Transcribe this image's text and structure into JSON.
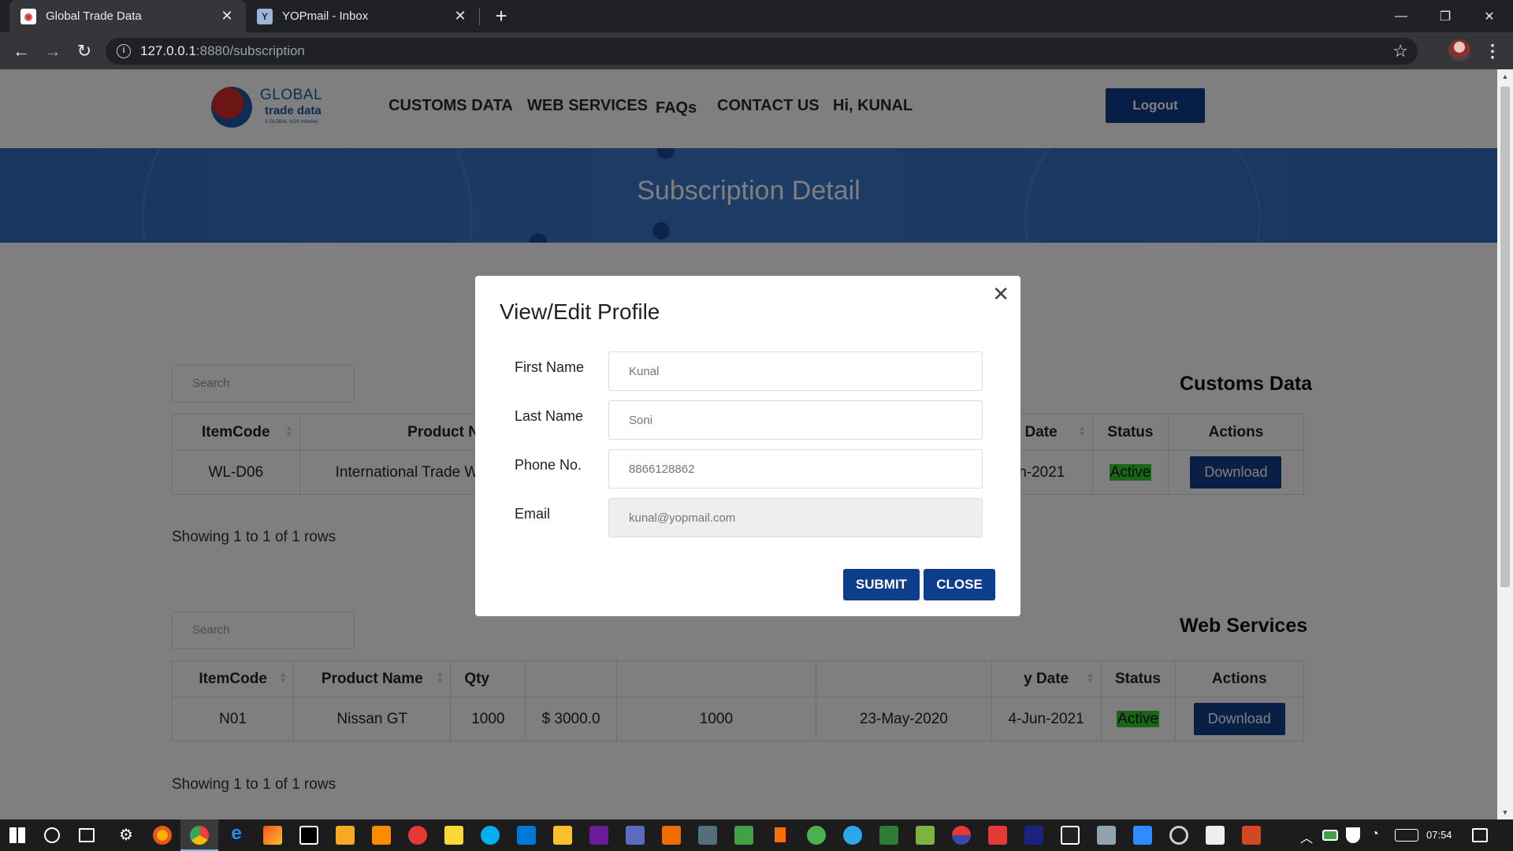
{
  "browser": {
    "tabs": [
      {
        "title": "Global Trade Data",
        "favicon": "gtd-globe-icon",
        "active": true
      },
      {
        "title": "YOPmail - Inbox",
        "favicon": "yopmail-icon",
        "active": false
      }
    ],
    "url": {
      "host": "127.0.0.1",
      "path": ":8880/subscription"
    }
  },
  "site": {
    "logo": {
      "line1": "GLOBAL",
      "line2": "trade data",
      "line3": "A GLOBAL VOX Initiative"
    },
    "nav": {
      "customs": "CUSTOMS DATA",
      "webservices": "WEB SERVICES",
      "faqs": "FAQs",
      "contact": "CONTACT US",
      "greeting": "Hi, KUNAL"
    },
    "logout": "Logout",
    "banner_title": "Subscription Detail"
  },
  "customs": {
    "title": "Customs Data",
    "search_placeholder": "Search",
    "headers": [
      "ItemCode",
      "Product Na",
      "y Date",
      "Status",
      "Actions"
    ],
    "row": {
      "itemcode": "WL-D06",
      "product": "International Trade Wa",
      "date": "un-2021",
      "status": "Active",
      "action": "Download"
    },
    "showing": "Showing 1 to 1 of 1 rows"
  },
  "webservices": {
    "title": "Web Services",
    "search_placeholder": "Search",
    "headers": [
      "ItemCode",
      "Product Name",
      "Qty",
      "",
      "",
      "",
      "y Date",
      "Status",
      "Actions"
    ],
    "row": {
      "itemcode": "N01",
      "product": "Nissan GT",
      "qty": "1000",
      "price": "$ 3000.0",
      "used": "1000",
      "start": "23-May-2020",
      "expiry": "4-Jun-2021",
      "status": "Active",
      "action": "Download"
    },
    "showing": "Showing 1 to 1 of 1 rows"
  },
  "modal": {
    "title": "View/Edit Profile",
    "fields": {
      "first_name": {
        "label": "First Name",
        "placeholder": "Kunal"
      },
      "last_name": {
        "label": "Last Name",
        "placeholder": "Soni"
      },
      "phone": {
        "label": "Phone No.",
        "placeholder": "8866128862"
      },
      "email": {
        "label": "Email",
        "placeholder": "kunal@yopmail.com"
      }
    },
    "submit": "SUBMIT",
    "close": "CLOSE"
  },
  "taskbar": {
    "time": "07:54"
  },
  "colors": {
    "primary": "#0e3d8c",
    "banner": "#3a78cc",
    "active_status": "#33cc33"
  }
}
